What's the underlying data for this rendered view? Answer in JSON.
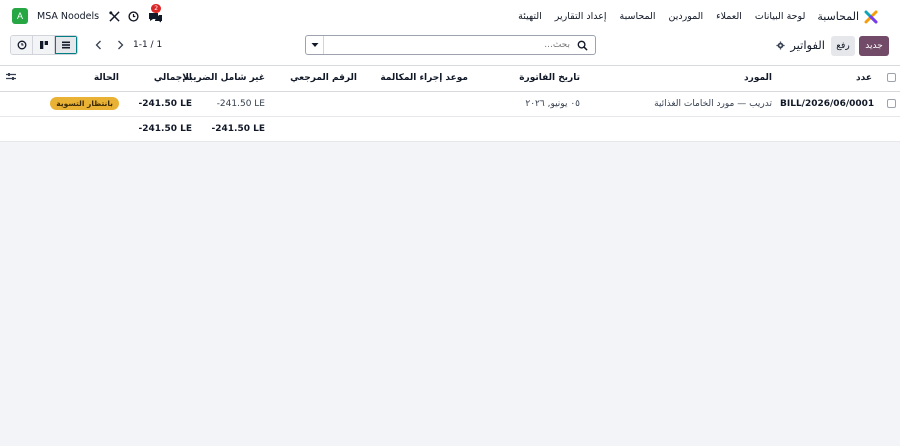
{
  "nav": {
    "app_name": "المحاسبة",
    "menu": [
      "لوحة البيانات",
      "العملاء",
      "الموردين",
      "المحاسبة",
      "إعداد التقارير",
      "التهيئة"
    ],
    "company": "MSA Noodels",
    "avatar_letter": "A",
    "chat_badge": "2"
  },
  "control": {
    "new_label": "جديد",
    "upload_label": "رفع",
    "breadcrumb": "الفواتير",
    "search_placeholder": "بحث...",
    "pager": "1-1 / 1"
  },
  "table": {
    "headers": {
      "number": "عدد",
      "vendor": "المورد",
      "invoice_date": "تاريخ الفاتورة",
      "activity": "موعد إجراء المكالمة",
      "reference": "الرقم المرجعي",
      "untaxed": "غير شامل الضريبة",
      "total": "الإجمالي",
      "status": "الحالة"
    },
    "rows": [
      {
        "number": "BILL/2026/06/0001",
        "vendor": "تدريب — مورد الخامات الغذائية",
        "invoice_date": "٠٥ يونيو, ٢٠٢٦",
        "activity": "",
        "reference": "",
        "untaxed": "-241.50 LE",
        "total": "-241.50 LE",
        "status": "بانتظار التسوية"
      }
    ],
    "totals": {
      "untaxed": "-241.50 LE",
      "total": "-241.50 LE"
    }
  },
  "colors": {
    "brand": "#714b67",
    "status_badge": "#e9b234",
    "avatar": "#27a744"
  }
}
